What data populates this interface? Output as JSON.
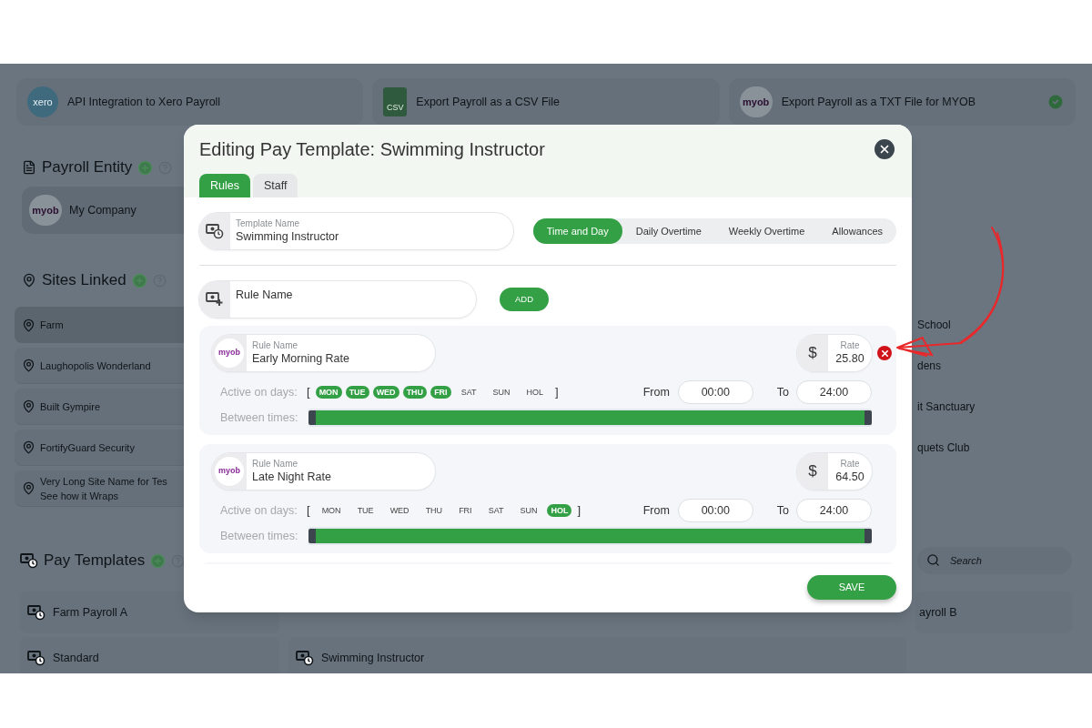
{
  "integrations": [
    {
      "kind": "teal_circle",
      "logo_text": "xero",
      "label": "API Integration to Xero Payroll",
      "checked": false
    },
    {
      "kind": "file",
      "logo_text": "CSV",
      "label": "Export Payroll as a CSV File",
      "checked": false
    },
    {
      "kind": "grey_circle",
      "logo_text": "myob",
      "label": "Export Payroll as a TXT File for MYOB",
      "checked": true
    }
  ],
  "payroll_entity": {
    "title": "Payroll Entity",
    "items": [
      {
        "logo_text": "myob",
        "label": "My Company"
      }
    ]
  },
  "sites": {
    "title": "Sites Linked",
    "left_items": [
      {
        "label": "Farm",
        "selected": true
      },
      {
        "label": "Laughopolis Wonderland",
        "selected": false
      },
      {
        "label": "Built Gympire",
        "selected": false
      },
      {
        "label": "FortifyGuard Security",
        "selected": false
      },
      {
        "label": "Very Long Site Name for Tes\nSee how it Wraps",
        "selected": false
      }
    ],
    "right_items": [
      {
        "label": "School",
        "selected": false
      },
      {
        "label": "dens",
        "selected": false
      },
      {
        "label": "it Sanctuary",
        "selected": false
      },
      {
        "label": "quets Club",
        "selected": false
      }
    ]
  },
  "pay_templates": {
    "title": "Pay Templates",
    "search": {
      "placeholder": "Search"
    },
    "left_items": [
      {
        "label": "Farm Payroll A"
      },
      {
        "label": "Standard"
      }
    ],
    "middle_items": [
      {
        "label": "Swimming Instructor"
      }
    ],
    "right_items": [
      {
        "label": "ayroll B"
      }
    ]
  },
  "modal": {
    "title": "Editing Pay Template: Swimming Instructor",
    "tabs": [
      {
        "label": "Rules",
        "selected": true
      },
      {
        "label": "Staff",
        "selected": false
      }
    ],
    "template_field": {
      "label": "Template Name",
      "value": "Swimming Instructor"
    },
    "rule_tabs": [
      {
        "label": "Time and Day",
        "selected": true
      },
      {
        "label": "Daily Overtime",
        "selected": false
      },
      {
        "label": "Weekly Overtime",
        "selected": false
      },
      {
        "label": "Allowances",
        "selected": false
      }
    ],
    "new_rule": {
      "placeholder": "Rule Name"
    },
    "add_button": "ADD",
    "rules": [
      {
        "logo_text": "myob",
        "name_label": "Rule Name",
        "name": "Early Morning Rate",
        "currency": "$",
        "rate_label": "Rate",
        "rate": "25.80",
        "removable": true,
        "days_label": "Active on days:",
        "bracket_open": "[",
        "bracket_close": "]",
        "days": [
          {
            "label": "MON",
            "selected": true
          },
          {
            "label": "TUE",
            "selected": true
          },
          {
            "label": "WED",
            "selected": true
          },
          {
            "label": "THU",
            "selected": true
          },
          {
            "label": "FRI",
            "selected": true
          },
          {
            "label": "SAT",
            "selected": false
          },
          {
            "label": "SUN",
            "selected": false
          },
          {
            "label": "HOL",
            "selected": false
          }
        ],
        "from_label": "From",
        "from": "00:00",
        "to_label": "To",
        "to": "24:00",
        "between_label": "Between times:",
        "level": 1
      },
      {
        "logo_text": "myob",
        "name_label": "Rule Name",
        "name": "Late Night Rate",
        "currency": "$",
        "rate_label": "Rate",
        "rate": "64.50",
        "removable": false,
        "days_label": "Active on days:",
        "bracket_open": "[",
        "bracket_close": "]",
        "days": [
          {
            "label": "MON",
            "selected": false
          },
          {
            "label": "TUE",
            "selected": false
          },
          {
            "label": "WED",
            "selected": false
          },
          {
            "label": "THU",
            "selected": false
          },
          {
            "label": "FRI",
            "selected": false
          },
          {
            "label": "SAT",
            "selected": false
          },
          {
            "label": "SUN",
            "selected": false
          },
          {
            "label": "HOL",
            "selected": true
          }
        ],
        "from_label": "From",
        "from": "00:00",
        "to_label": "To",
        "to": "24:00",
        "between_label": "Between times:",
        "level": 1
      }
    ],
    "save_button": "SAVE"
  }
}
